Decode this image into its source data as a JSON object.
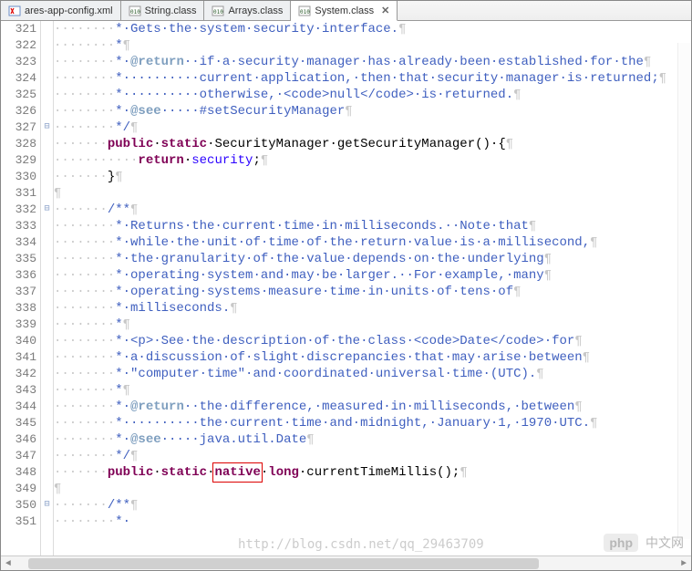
{
  "tabs": [
    {
      "label": "ares-app-config.xml",
      "iconKind": "xml",
      "active": false,
      "closable": false
    },
    {
      "label": "String.class",
      "iconKind": "class",
      "active": false,
      "closable": false
    },
    {
      "label": "Arrays.class",
      "iconKind": "class",
      "active": false,
      "closable": false
    },
    {
      "label": "System.class",
      "iconKind": "class",
      "active": true,
      "closable": true
    }
  ],
  "line_start": 321,
  "line_end": 351,
  "fold": {
    "327": "minus",
    "332": "minus",
    "350": "minus"
  },
  "lines": {
    "321": [
      [
        "ws",
        "········"
      ],
      [
        "jd",
        "*·Gets·the·system·security·interface."
      ],
      [
        "pilcrow",
        "¶"
      ]
    ],
    "322": [
      [
        "ws",
        "········"
      ],
      [
        "jd",
        "*"
      ],
      [
        "pilcrow",
        "¶"
      ]
    ],
    "323": [
      [
        "ws",
        "········"
      ],
      [
        "jd",
        "*·"
      ],
      [
        "tg",
        "@return"
      ],
      [
        "jd",
        "··if·a·security·manager·has·already·been·established·for·the"
      ],
      [
        "pilcrow",
        "¶"
      ]
    ],
    "324": [
      [
        "ws",
        "········"
      ],
      [
        "jd",
        "*··········current·application,·then·that·security·manager·is·returned;"
      ],
      [
        "pilcrow",
        "¶"
      ]
    ],
    "325": [
      [
        "ws",
        "········"
      ],
      [
        "jd",
        "*··········otherwise,·<code>null</code>·is·returned."
      ],
      [
        "pilcrow",
        "¶"
      ]
    ],
    "326": [
      [
        "ws",
        "········"
      ],
      [
        "jd",
        "*·"
      ],
      [
        "tg",
        "@see"
      ],
      [
        "jd",
        "·····#setSecurityManager"
      ],
      [
        "pilcrow",
        "¶"
      ]
    ],
    "327": [
      [
        "ws",
        "········"
      ],
      [
        "jd",
        "*/"
      ],
      [
        "pilcrow",
        "¶"
      ]
    ],
    "328": [
      [
        "ws",
        "·······"
      ],
      [
        "kw",
        "public"
      ],
      [
        "cd",
        "·"
      ],
      [
        "kw",
        "static"
      ],
      [
        "cd",
        "·SecurityManager·getSecurityManager()·{"
      ],
      [
        "pilcrow",
        "¶"
      ]
    ],
    "329": [
      [
        "ws",
        "···········"
      ],
      [
        "kw",
        "return"
      ],
      [
        "cd",
        "·"
      ],
      [
        "st",
        "security"
      ],
      [
        "cd",
        ";"
      ],
      [
        "pilcrow",
        "¶"
      ]
    ],
    "330": [
      [
        "ws",
        "·······"
      ],
      [
        "cd",
        "}"
      ],
      [
        "pilcrow",
        "¶"
      ]
    ],
    "331": [
      [
        "pilcrow",
        "¶"
      ]
    ],
    "332": [
      [
        "ws",
        "·······"
      ],
      [
        "jd",
        "/**"
      ],
      [
        "pilcrow",
        "¶"
      ]
    ],
    "333": [
      [
        "ws",
        "········"
      ],
      [
        "jd",
        "*·Returns·the·current·time·in·milliseconds.··Note·that"
      ],
      [
        "pilcrow",
        "¶"
      ]
    ],
    "334": [
      [
        "ws",
        "········"
      ],
      [
        "jd",
        "*·while·the·unit·of·time·of·the·return·value·is·a·millisecond,"
      ],
      [
        "pilcrow",
        "¶"
      ]
    ],
    "335": [
      [
        "ws",
        "········"
      ],
      [
        "jd",
        "*·the·granularity·of·the·value·depends·on·the·underlying"
      ],
      [
        "pilcrow",
        "¶"
      ]
    ],
    "336": [
      [
        "ws",
        "········"
      ],
      [
        "jd",
        "*·operating·system·and·may·be·larger.··For·example,·many"
      ],
      [
        "pilcrow",
        "¶"
      ]
    ],
    "337": [
      [
        "ws",
        "········"
      ],
      [
        "jd",
        "*·operating·systems·measure·time·in·units·of·tens·of"
      ],
      [
        "pilcrow",
        "¶"
      ]
    ],
    "338": [
      [
        "ws",
        "········"
      ],
      [
        "jd",
        "*·milliseconds."
      ],
      [
        "pilcrow",
        "¶"
      ]
    ],
    "339": [
      [
        "ws",
        "········"
      ],
      [
        "jd",
        "*"
      ],
      [
        "pilcrow",
        "¶"
      ]
    ],
    "340": [
      [
        "ws",
        "········"
      ],
      [
        "jd",
        "*·<p>·See·the·description·of·the·class·<code>Date</code>·for"
      ],
      [
        "pilcrow",
        "¶"
      ]
    ],
    "341": [
      [
        "ws",
        "········"
      ],
      [
        "jd",
        "*·a·discussion·of·slight·discrepancies·that·may·arise·between"
      ],
      [
        "pilcrow",
        "¶"
      ]
    ],
    "342": [
      [
        "ws",
        "········"
      ],
      [
        "jd",
        "*·\"computer·time\"·and·coordinated·universal·time·(UTC)."
      ],
      [
        "pilcrow",
        "¶"
      ]
    ],
    "343": [
      [
        "ws",
        "········"
      ],
      [
        "jd",
        "*"
      ],
      [
        "pilcrow",
        "¶"
      ]
    ],
    "344": [
      [
        "ws",
        "········"
      ],
      [
        "jd",
        "*·"
      ],
      [
        "tg",
        "@return"
      ],
      [
        "jd",
        "··the·difference,·measured·in·milliseconds,·between"
      ],
      [
        "pilcrow",
        "¶"
      ]
    ],
    "345": [
      [
        "ws",
        "········"
      ],
      [
        "jd",
        "*··········the·current·time·and·midnight,·January·1,·1970·UTC."
      ],
      [
        "pilcrow",
        "¶"
      ]
    ],
    "346": [
      [
        "ws",
        "········"
      ],
      [
        "jd",
        "*·"
      ],
      [
        "tg",
        "@see"
      ],
      [
        "jd",
        "·····java.util.Date"
      ],
      [
        "pilcrow",
        "¶"
      ]
    ],
    "347": [
      [
        "ws",
        "········"
      ],
      [
        "jd",
        "*/"
      ],
      [
        "pilcrow",
        "¶"
      ]
    ],
    "348": [
      [
        "ws",
        "·······"
      ],
      [
        "kw",
        "public"
      ],
      [
        "cd",
        "·"
      ],
      [
        "kw",
        "static"
      ],
      [
        "cd",
        "·"
      ],
      [
        "kw",
        "native"
      ],
      [
        "cd",
        "·"
      ],
      [
        "kw",
        "long"
      ],
      [
        "cd",
        "·currentTimeMillis();"
      ],
      [
        "pilcrow",
        "¶"
      ]
    ],
    "349": [
      [
        "pilcrow",
        "¶"
      ]
    ],
    "350": [
      [
        "ws",
        "·······"
      ],
      [
        "jd",
        "/**"
      ],
      [
        "pilcrow",
        "¶"
      ]
    ],
    "351": [
      [
        "ws",
        "········"
      ],
      [
        "jd",
        "*·"
      ]
    ]
  },
  "highlight": {
    "line": 348,
    "word": "native"
  },
  "watermark": {
    "badge": "php",
    "text": "中文网"
  },
  "faded_url": "http://blog.csdn.net/qq_29463709"
}
